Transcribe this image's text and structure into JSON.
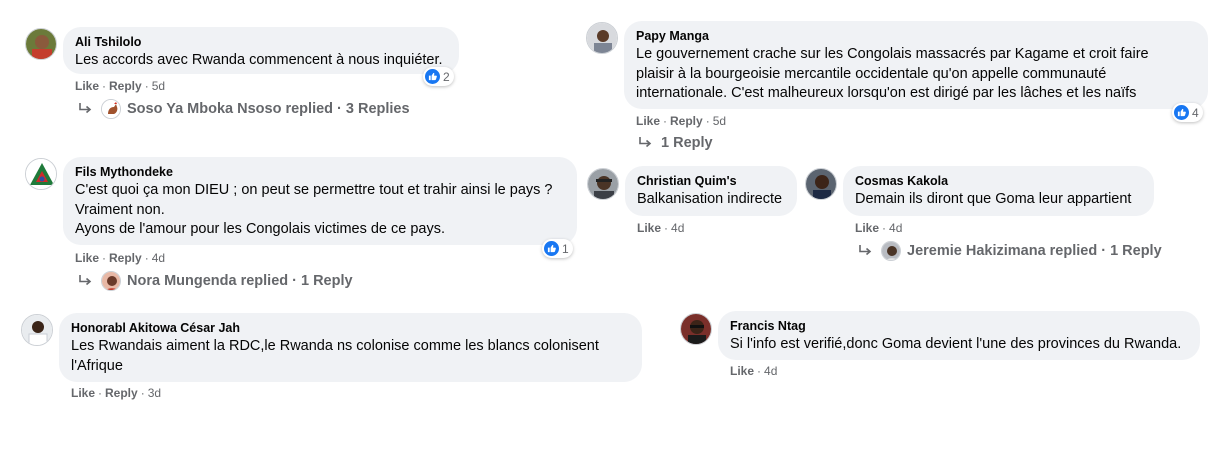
{
  "actions": {
    "like": "Like",
    "reply": "Reply",
    "separator": "·"
  },
  "comments": [
    {
      "author": "Ali Tshilolo",
      "text": "Les accords avec Rwanda commencent à nous inquiéter.",
      "time": "5d",
      "reactions": "2",
      "replies": {
        "replier": "Soso Ya Mboka Nsoso replied",
        "count": "3 Replies"
      }
    },
    {
      "author": "Papy Manga",
      "text": "Le gouvernement crache sur les Congolais massacrés par Kagame et croit faire\nplaisir à la bourgeoisie mercantile occidentale qu'on appelle communauté\ninternationale. C'est malheureux lorsqu'on est dirigé par les lâches et les naïfs",
      "time": "5d",
      "reactions": "4",
      "replies": {
        "count": "1 Reply"
      }
    },
    {
      "author": "Fils Mythondeke",
      "text": "C'est quoi ça mon DIEU ; on peut se permettre tout et trahir ainsi le pays ?\nVraiment non.\nAyons de l'amour pour les Congolais victimes de ce pays.",
      "time": "4d",
      "reactions": "1",
      "replies": {
        "replier": "Nora Mungenda replied",
        "count": "1 Reply"
      }
    },
    {
      "author": "Christian Quim's",
      "text": "Balkanisation indirecte",
      "time": "4d"
    },
    {
      "author": "Cosmas Kakola",
      "text": "Demain ils diront que Goma leur appartient",
      "time": "4d",
      "replies": {
        "replier": "Jeremie Hakizimana replied",
        "count": "1 Reply"
      }
    },
    {
      "author": "Honorabl Akitowa César Jah",
      "text": "Les Rwandais aiment la RDC,le Rwanda ns colonise comme les blancs colonisent\nl'Afrique",
      "time": "3d"
    },
    {
      "author": "Francis Ntag",
      "text": "Si l'info est verifié,donc Goma devient l'une des provinces du Rwanda.",
      "time": "4d"
    }
  ],
  "icons": {
    "like": "like-thumb-icon",
    "reply_arrow": "reply-arrow-icon"
  },
  "colors": {
    "bubble": "#f0f2f5",
    "meta": "#65676b",
    "like_blue": "#1877f2"
  }
}
